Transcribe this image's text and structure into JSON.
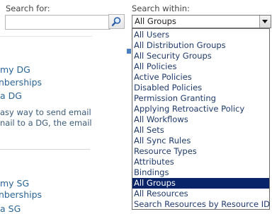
{
  "search": {
    "label": "Search for:",
    "value": "",
    "button_icon": "search-icon"
  },
  "scope": {
    "label": "Search within:",
    "selected": "All Groups",
    "options": [
      "All Users",
      "All Distribution Groups",
      "All Security Groups",
      "All Policies",
      "Active Policies",
      "Disabled Policies",
      "Permission Granting",
      "Applying Retroactive Policy",
      "All Workflows",
      "All Sets",
      "All Sync Rules",
      "Resource Types",
      "Attributes",
      "Bindings",
      "All Groups",
      "All Resources",
      "Search Resources by Resource ID"
    ],
    "selected_index": 14
  },
  "dg_section": {
    "title": "my DG",
    "subtitle": "nberships",
    "link": "a DG",
    "desc_line1": "asy way to send email",
    "desc_line2": "nail to a DG, the email"
  },
  "sg_section": {
    "title": "my SG",
    "subtitle": "nberships",
    "link": "a SG"
  },
  "colors": {
    "selected_bg": "#0a246a",
    "link": "#2a6496"
  }
}
